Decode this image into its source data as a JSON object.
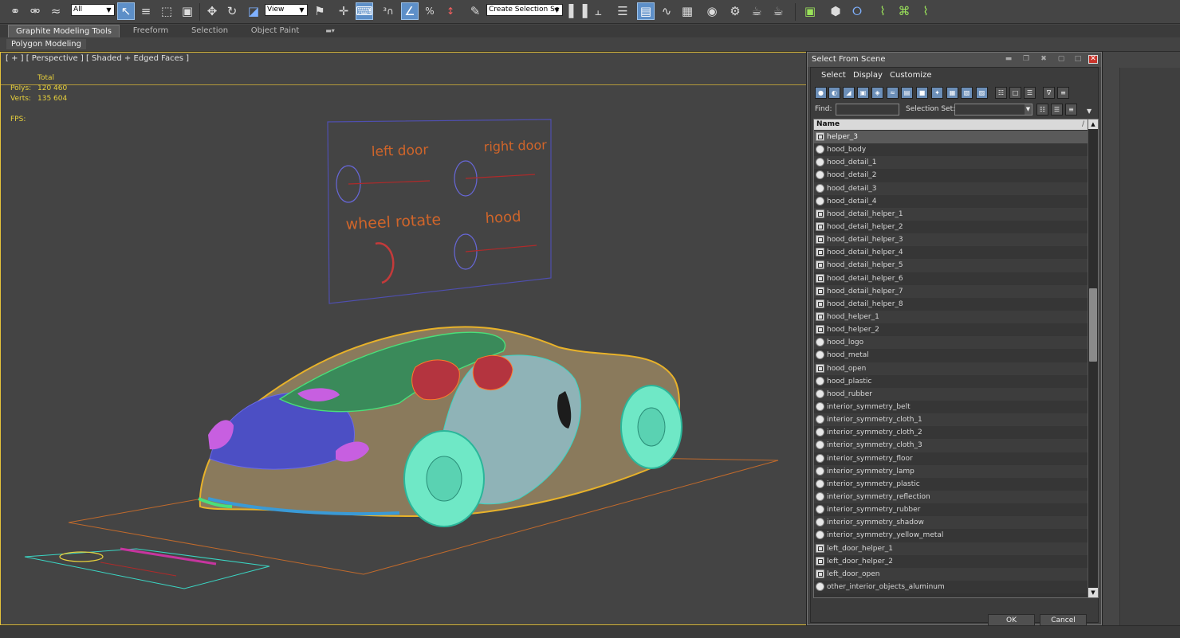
{
  "toolbar": {
    "selection_filter": "All",
    "reference_coord": "View",
    "named_selection": "Create Selection Se",
    "icons": [
      "link-icon",
      "unlink-icon",
      "bind-space-warp-icon",
      "select-object-icon",
      "select-by-name-icon",
      "rectangular-selection-icon",
      "window-crossing-icon",
      "move-icon",
      "rotate-icon",
      "scale-icon",
      "pivot-center-icon",
      "select-manipulate-icon",
      "keyboard-shortcut-icon",
      "snap-3-icon",
      "angle-snap-icon",
      "percent-snap-icon",
      "spinner-snap-icon",
      "edit-named-selection-icon",
      "mirror-icon",
      "align-icon",
      "layer-manager-icon",
      "ribbon-toggle-icon",
      "curve-editor-icon",
      "schematic-view-icon",
      "material-editor-icon",
      "render-setup-icon",
      "rendered-frame-icon",
      "render-icon",
      "extra-tools-icon",
      "pack-icon",
      "cloth-icon",
      "deform-icon",
      "assembly-icon",
      "link-constraint-icon"
    ]
  },
  "ribbon": {
    "tabs": [
      "Graphite Modeling Tools",
      "Freeform",
      "Selection",
      "Object Paint"
    ],
    "active_tab": "Graphite Modeling Tools",
    "panel_label": "Polygon Modeling"
  },
  "viewport": {
    "label": "[ + ] [ Perspective ] [ Shaded + Edged Faces ]",
    "stats": {
      "total_label": "Total",
      "polys_label": "Polys:",
      "polys_value": "120 460",
      "verts_label": "Verts:",
      "verts_value": "135 604",
      "fps_label": "FPS:"
    },
    "control_panel": {
      "labels": [
        "left door",
        "right door",
        "wheel rotate",
        "hood"
      ]
    }
  },
  "dialog": {
    "title": "Select From Scene",
    "menu": [
      "Select",
      "Display",
      "Customize"
    ],
    "find_label": "Find:",
    "find_value": "",
    "selection_set_label": "Selection Set:",
    "selection_set_value": "",
    "column_header": "Name",
    "ok_label": "OK",
    "cancel_label": "Cancel",
    "objects": [
      {
        "name": "helper_3",
        "type": "helper",
        "selected": true
      },
      {
        "name": "hood_body",
        "type": "geometry"
      },
      {
        "name": "hood_detail_1",
        "type": "geometry"
      },
      {
        "name": "hood_detail_2",
        "type": "geometry"
      },
      {
        "name": "hood_detail_3",
        "type": "geometry"
      },
      {
        "name": "hood_detail_4",
        "type": "geometry"
      },
      {
        "name": "hood_detail_helper_1",
        "type": "helper"
      },
      {
        "name": "hood_detail_helper_2",
        "type": "helper"
      },
      {
        "name": "hood_detail_helper_3",
        "type": "helper"
      },
      {
        "name": "hood_detail_helper_4",
        "type": "helper"
      },
      {
        "name": "hood_detail_helper_5",
        "type": "helper"
      },
      {
        "name": "hood_detail_helper_6",
        "type": "helper"
      },
      {
        "name": "hood_detail_helper_7",
        "type": "helper"
      },
      {
        "name": "hood_detail_helper_8",
        "type": "helper"
      },
      {
        "name": "hood_helper_1",
        "type": "helper"
      },
      {
        "name": "hood_helper_2",
        "type": "helper"
      },
      {
        "name": "hood_logo",
        "type": "geometry"
      },
      {
        "name": "hood_metal",
        "type": "geometry"
      },
      {
        "name": "hood_open",
        "type": "helper"
      },
      {
        "name": "hood_plastic",
        "type": "geometry"
      },
      {
        "name": "hood_rubber",
        "type": "geometry"
      },
      {
        "name": "interior_symmetry_belt",
        "type": "geometry"
      },
      {
        "name": "interior_symmetry_cloth_1",
        "type": "geometry"
      },
      {
        "name": "interior_symmetry_cloth_2",
        "type": "geometry"
      },
      {
        "name": "interior_symmetry_cloth_3",
        "type": "geometry"
      },
      {
        "name": "interior_symmetry_floor",
        "type": "geometry"
      },
      {
        "name": "interior_symmetry_lamp",
        "type": "geometry"
      },
      {
        "name": "interior_symmetry_plastic",
        "type": "geometry"
      },
      {
        "name": "interior_symmetry_reflection",
        "type": "geometry"
      },
      {
        "name": "interior_symmetry_rubber",
        "type": "geometry"
      },
      {
        "name": "interior_symmetry_shadow",
        "type": "geometry"
      },
      {
        "name": "interior_symmetry_yellow_metal",
        "type": "geometry"
      },
      {
        "name": "left_door_helper_1",
        "type": "helper"
      },
      {
        "name": "left_door_helper_2",
        "type": "helper"
      },
      {
        "name": "left_door_open",
        "type": "helper"
      },
      {
        "name": "other_interior_objects_aluminum",
        "type": "geometry"
      }
    ]
  }
}
